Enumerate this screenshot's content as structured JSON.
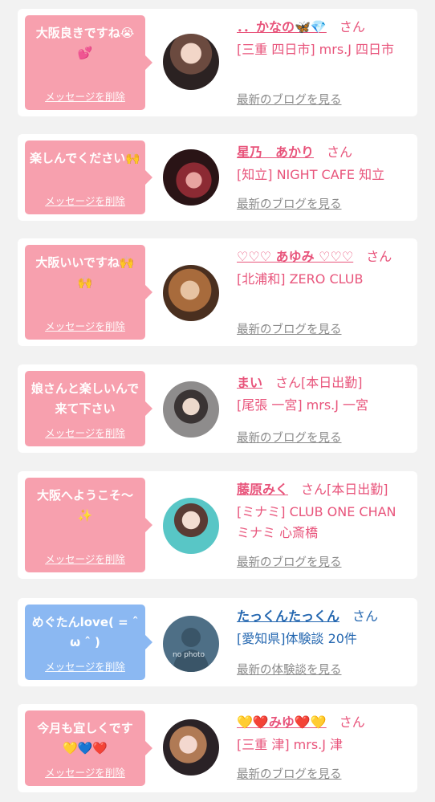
{
  "colors": {
    "accent_pink": "#e8547b",
    "bubble_pink": "#f7a0ae",
    "bubble_blue": "#8bb8f2",
    "link_blue": "#2467b0",
    "muted": "#8a8a8a"
  },
  "entries": [
    {
      "message": "大阪良きですね😭💕",
      "delete_label": "メッセージを削除",
      "name": "．．かなの🦋💎",
      "san": "さん",
      "shop": "[三重 四日市] mrs.J 四日市",
      "blog_link": "最新のブログを見る"
    },
    {
      "message": "楽しんでください🙌",
      "delete_label": "メッセージを削除",
      "name": "星乃　あかり",
      "san": "さん",
      "shop": "[知立] NIGHT CAFE 知立",
      "blog_link": "最新のブログを見る"
    },
    {
      "message": "大阪いいですね🙌🙌",
      "delete_label": "メッセージを削除",
      "name": "♡♡♡ あゆみ ♡♡♡",
      "san": "さん",
      "shop": "[北浦和] ZERO CLUB",
      "blog_link": "最新のブログを見る"
    },
    {
      "message": "娘さんと楽しいんで来て下さい",
      "delete_label": "メッセージを削除",
      "name": "まい",
      "san": "さん[本日出勤]",
      "shop": "[尾張 一宮] mrs.J 一宮",
      "blog_link": "最新のブログを見る"
    },
    {
      "message": "大阪へようこそ〜✨",
      "delete_label": "メッセージを削除",
      "name": "藤原みく",
      "san": "さん[本日出勤]",
      "shop": "[ミナミ] CLUB ONE CHAN ミナミ 心斎橋",
      "blog_link": "最新のブログを見る"
    },
    {
      "message": "めぐたんlove( = ˆ ω ˆ )",
      "delete_label": "メッセージを削除",
      "name": "たっくんたっくん",
      "san": "さん",
      "shop": "[愛知県]体験談 20件",
      "blog_link": "最新の体験談を見る",
      "avatar_text": "no photo"
    },
    {
      "message": "今月も宜しくです💛💙❤️",
      "delete_label": "メッセージを削除",
      "name": "💛❤️みゆ❤️💛",
      "san": "さん",
      "shop": "[三重 津] mrs.J 津",
      "blog_link": "最新のブログを見る"
    }
  ]
}
